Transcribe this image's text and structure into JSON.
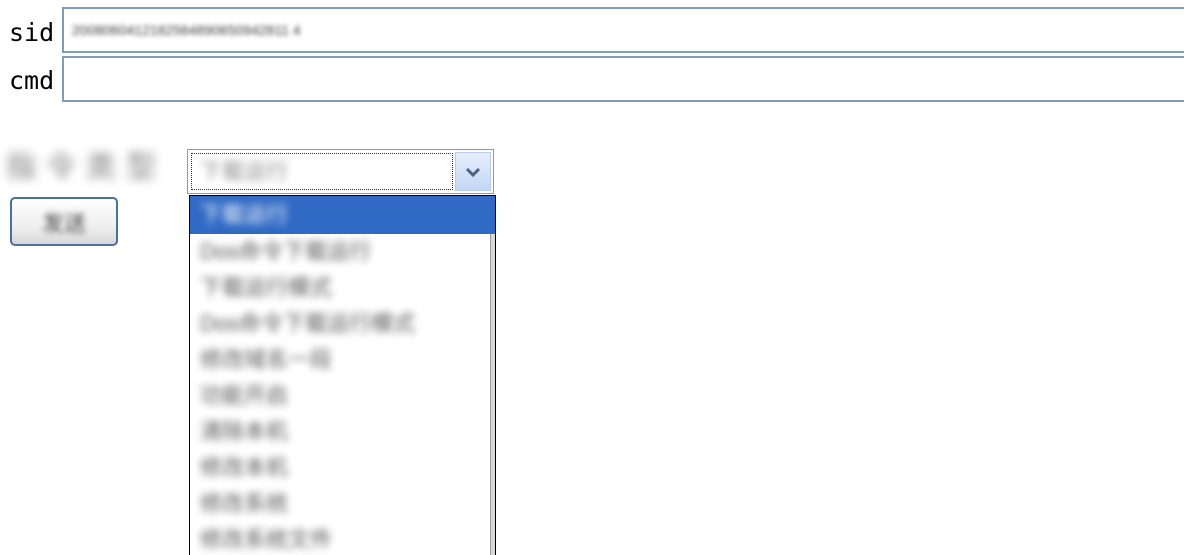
{
  "form": {
    "sid_label": "sid",
    "sid_value": "2008060412182564890650942811 4",
    "cmd_label": "cmd",
    "cmd_value": "",
    "type_label": "指令类型",
    "send_label": "发送"
  },
  "select": {
    "selected_value": "下载运行"
  },
  "dropdown": {
    "options": [
      "下载运行",
      "Dos命令下载运行",
      "下载运行模式",
      "Dos命令下载运行模式",
      "修改域名一段",
      "功能开启",
      "清除本机",
      "修改本机",
      "修改系统",
      "修改系统文件"
    ],
    "highlighted_index": 0
  },
  "colors": {
    "highlight": "#316ac5",
    "input_border": "#7f9db9",
    "button_border": "#4c6f9c"
  },
  "icons": {
    "dropdown_arrow": "chevron-down-icon"
  }
}
